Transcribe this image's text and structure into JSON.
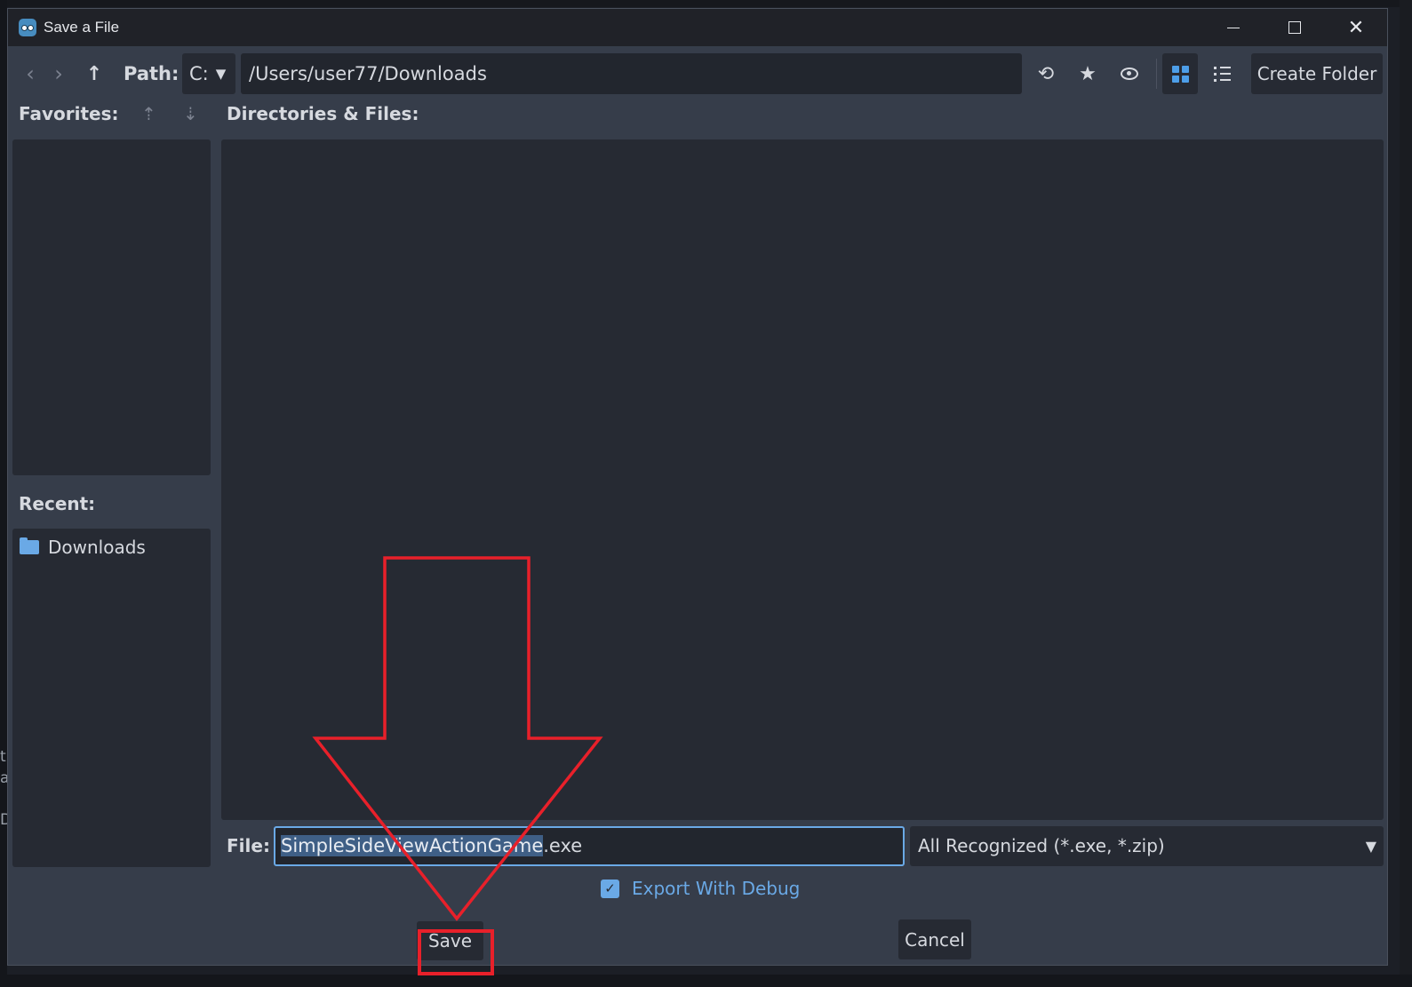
{
  "window": {
    "title": "Save a File"
  },
  "toolbar": {
    "path_label": "Path:",
    "drive": "C:",
    "path": "/Users/user77/Downloads",
    "create_folder": "Create Folder"
  },
  "favorites": {
    "label": "Favorites:"
  },
  "recent": {
    "label": "Recent:",
    "items": [
      "Downloads"
    ]
  },
  "directory": {
    "label": "Directories & Files:"
  },
  "file": {
    "label": "File:",
    "name_selected": "SimpleSideViewActionGame",
    "extension": ".exe",
    "filter": "All Recognized (*.exe, *.zip)"
  },
  "options": {
    "export_debug": "Export With Debug",
    "export_debug_checked": true
  },
  "buttons": {
    "save": "Save",
    "cancel": "Cancel"
  },
  "background_fragments": [
    "t",
    "a",
    "D"
  ],
  "colors": {
    "accent": "#6aa9e6",
    "annotation": "#e8202a",
    "panel": "#262a33",
    "window": "#363d4a"
  },
  "icons": {
    "back": "chevron-left-icon",
    "forward": "chevron-right-icon",
    "up": "arrow-up-icon",
    "refresh": "refresh-icon",
    "favorite": "star-icon",
    "hidden": "eye-icon",
    "grid": "grid-view-icon",
    "list": "list-view-icon",
    "folder": "folder-icon"
  }
}
